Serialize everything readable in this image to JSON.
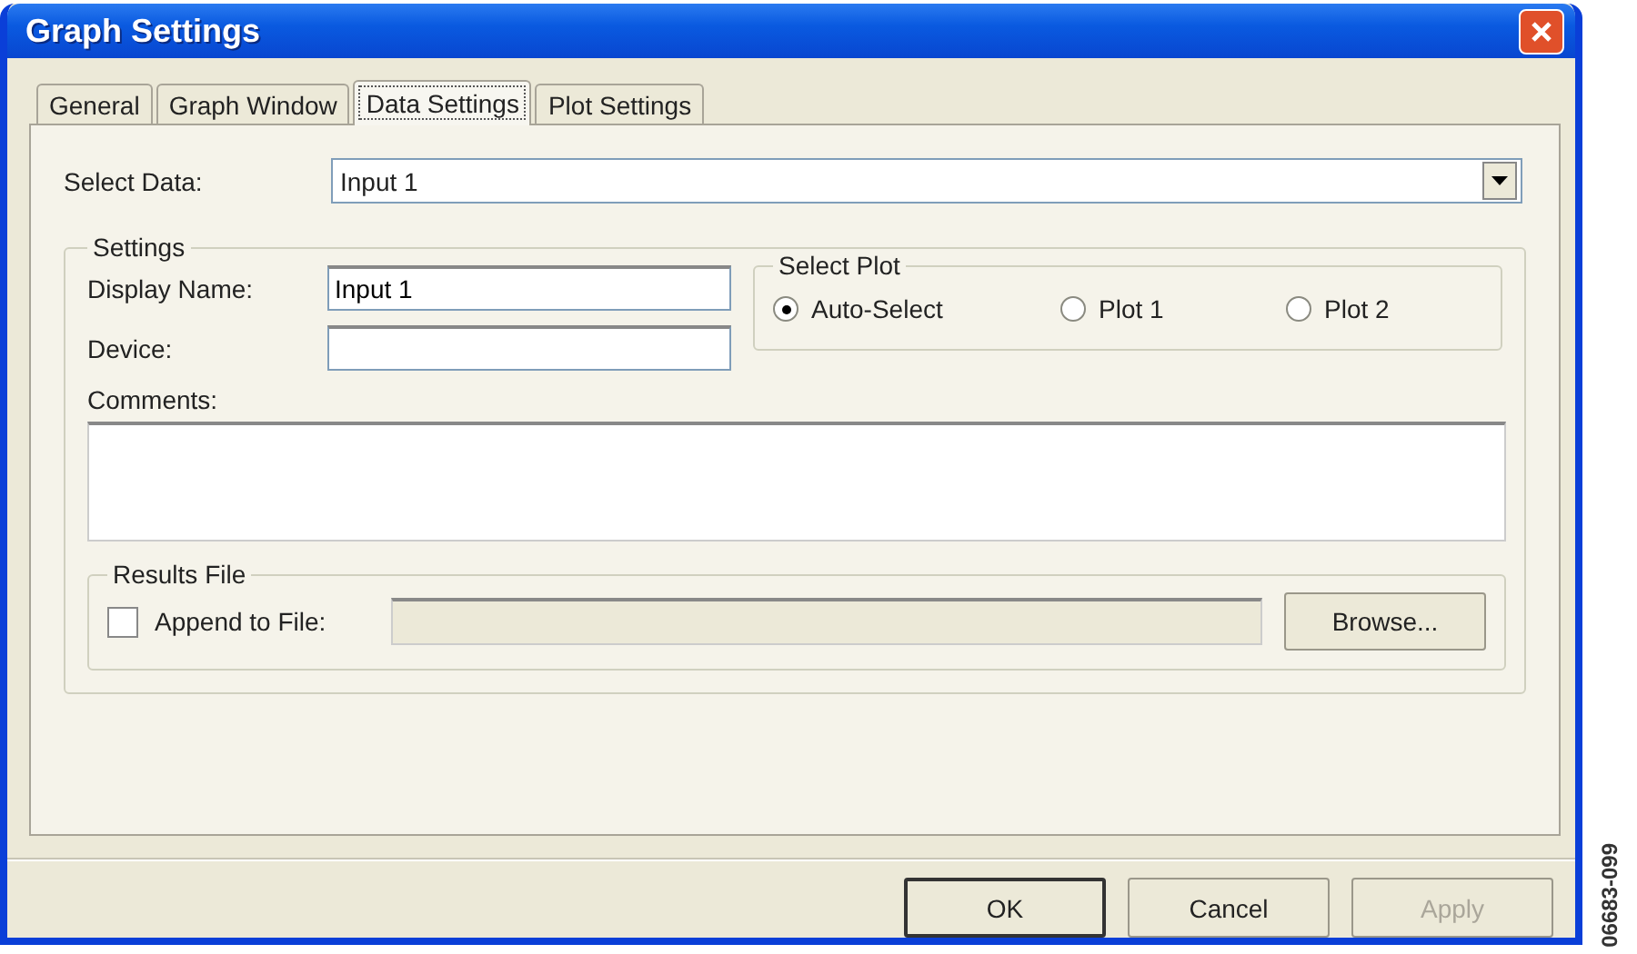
{
  "window": {
    "title": "Graph Settings"
  },
  "tabs": [
    {
      "label": "General",
      "selected": false
    },
    {
      "label": "Graph Window",
      "selected": false
    },
    {
      "label": "Data Settings",
      "selected": true
    },
    {
      "label": "Plot Settings",
      "selected": false
    }
  ],
  "select_data": {
    "label": "Select Data:",
    "value": "Input 1"
  },
  "settings": {
    "title": "Settings",
    "display_name": {
      "label": "Display Name:",
      "value": "Input 1"
    },
    "device": {
      "label": "Device:"
    },
    "select_plot": {
      "title": "Select Plot",
      "options": [
        {
          "label": "Auto-Select",
          "selected": true
        },
        {
          "label": "Plot 1",
          "selected": false
        },
        {
          "label": "Plot 2",
          "selected": false
        }
      ]
    },
    "comments": {
      "label": "Comments:"
    },
    "results_file": {
      "title": "Results File",
      "append": {
        "label": "Append to File:",
        "checked": false
      },
      "path_field": {
        "disabled": true
      },
      "browse": {
        "label": "Browse..."
      }
    }
  },
  "buttons": [
    {
      "label": "OK",
      "default": true,
      "disabled": false
    },
    {
      "label": "Cancel",
      "default": false,
      "disabled": false
    },
    {
      "label": "Apply",
      "default": false,
      "disabled": true
    }
  ],
  "figure_id": "06683-099"
}
